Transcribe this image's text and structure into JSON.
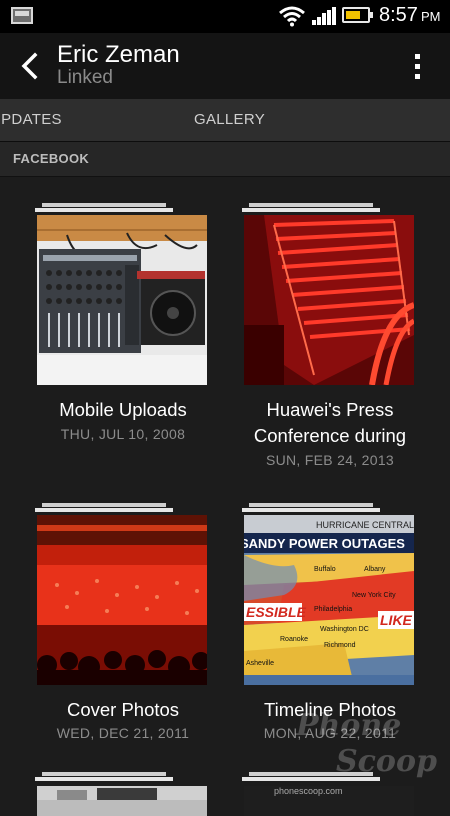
{
  "status_bar": {
    "time": "8:57",
    "ampm": "PM",
    "icons": [
      "gallery-notification-icon",
      "wifi-icon",
      "signal-icon",
      "battery-icon"
    ]
  },
  "header": {
    "title": "Eric Zeman",
    "subtitle": "Linked"
  },
  "tabs": [
    {
      "label": "UPDATES"
    },
    {
      "label": "GALLERY",
      "selected": true
    }
  ],
  "section": {
    "label": "FACEBOOK"
  },
  "albums": [
    {
      "name": "Mobile Uploads",
      "date": "THU, JUL 10, 2008"
    },
    {
      "name": "Huawei's Press Conference during",
      "date": "SUN, FEB 24, 2013"
    },
    {
      "name": "Cover Photos",
      "date": "WED, DEC 21, 2011"
    },
    {
      "name": "Timeline Photos",
      "date": "MON, AUG 22, 2011"
    }
  ],
  "thumb_text": {
    "map_brand": "HURRICANE CENTRAL",
    "map_headline": "SANDY POWER OUTAGES",
    "map_cities": [
      "Buffalo",
      "Albany",
      "New York City",
      "Philadelphia",
      "Washington DC",
      "Roanoke",
      "Richmond",
      "Asheville"
    ],
    "map_left_word": "ESSIBLE",
    "map_right_word": "LIKE",
    "partial_caption": "phonescoop.com"
  },
  "watermark": {
    "line1": "Phone",
    "line2": "Scoop"
  },
  "colors": {
    "accent": "#f2c200",
    "background": "#1c1c1c"
  }
}
